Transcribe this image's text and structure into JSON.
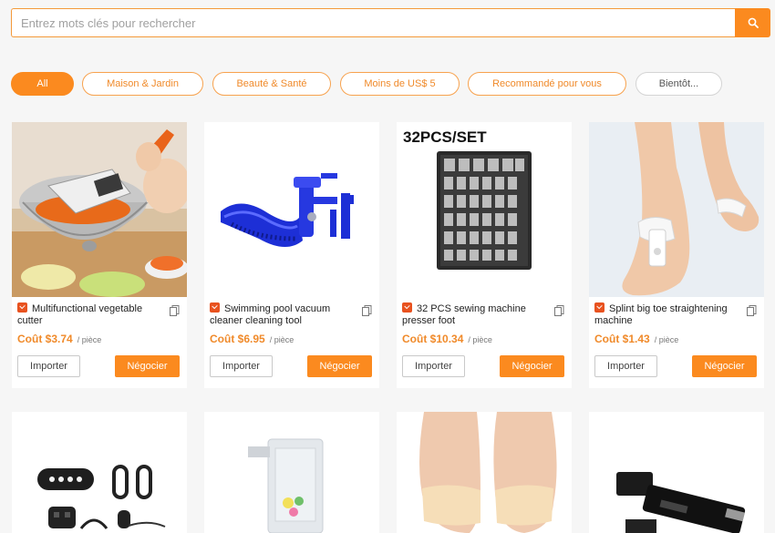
{
  "search": {
    "placeholder": "Entrez mots clés pour rechercher"
  },
  "categories": [
    {
      "label": "All",
      "active": true
    },
    {
      "label": "Maison & Jardin"
    },
    {
      "label": "Beauté & Santé"
    },
    {
      "label": "Moins de US$ 5"
    },
    {
      "label": "Recommandé pour vous"
    },
    {
      "label": "Bientôt..."
    }
  ],
  "card_actions": {
    "import_label": "Importer",
    "negotiate_label": "Négocier",
    "price_prefix": "Coût",
    "unit_label": "/ pièce"
  },
  "products": [
    {
      "title": "Multifunctional vegetable cutter",
      "price": "$3.74"
    },
    {
      "title": "Swimming pool vacuum cleaner cleaning tool",
      "price": "$6.95"
    },
    {
      "title": "32 PCS sewing machine presser foot",
      "price": "$10.34",
      "image_caption": "32PCS/SET"
    },
    {
      "title": "Splint big toe straightening machine",
      "price": "$1.43"
    }
  ],
  "colors": {
    "accent": "#fb8a1f",
    "tag_border": "#f7a24e",
    "title_flag": "#e8521f"
  }
}
